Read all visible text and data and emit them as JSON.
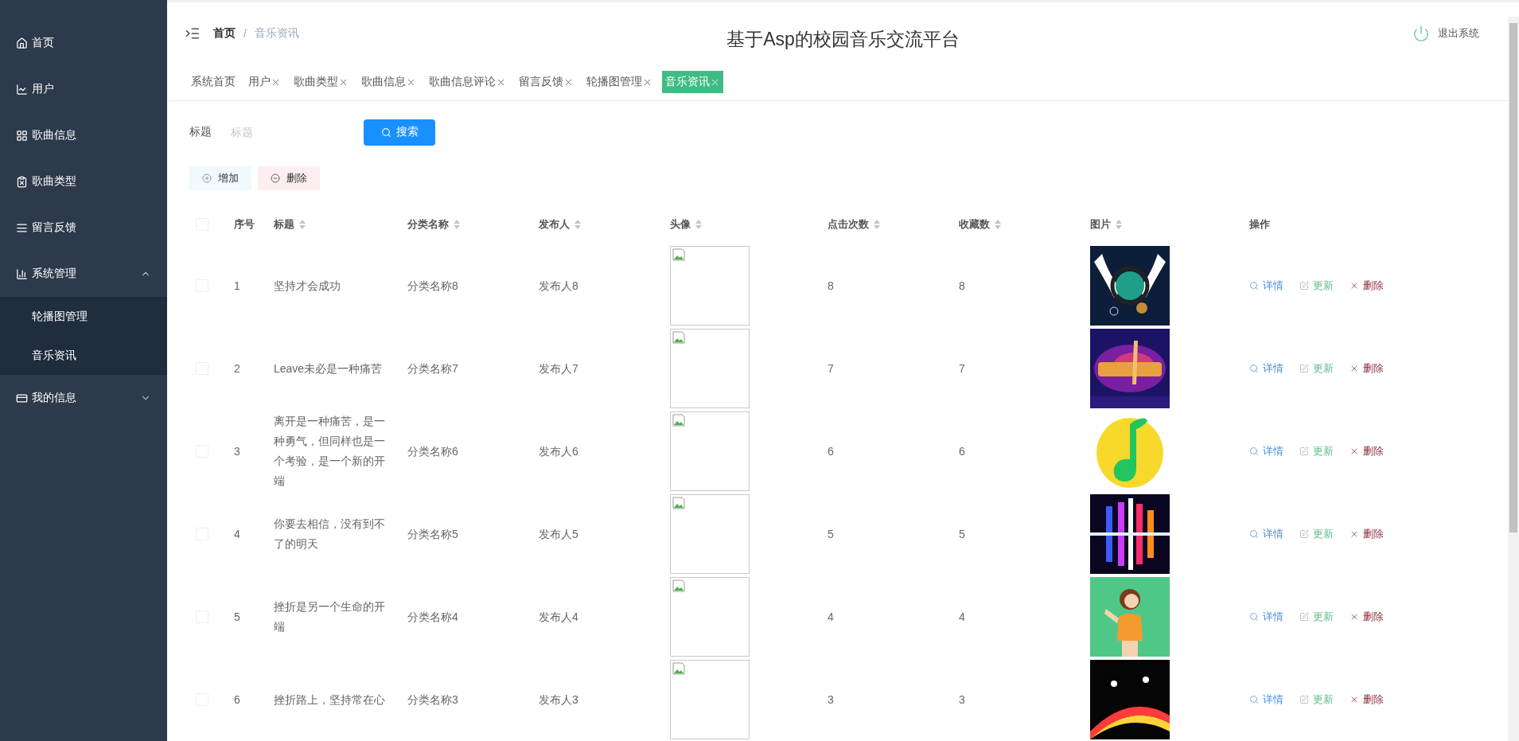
{
  "sidebar": {
    "items": [
      {
        "label": "首页"
      },
      {
        "label": "用户"
      },
      {
        "label": "歌曲信息"
      },
      {
        "label": "歌曲类型"
      },
      {
        "label": "留言反馈"
      },
      {
        "label": "系统管理",
        "expanded": true,
        "children": [
          {
            "label": "轮播图管理"
          },
          {
            "label": "音乐资讯"
          }
        ]
      },
      {
        "label": "我的信息",
        "expanded": false
      }
    ]
  },
  "header": {
    "breadcrumb": [
      "首页",
      "音乐资讯"
    ],
    "breadcrumb_separator": "/",
    "title": "基于Asp的校园音乐交流平台",
    "logout": "退出系统"
  },
  "tabs": [
    {
      "label": "系统首页",
      "closable": false,
      "selected": false
    },
    {
      "label": "用户",
      "closable": true,
      "selected": false
    },
    {
      "label": "歌曲类型",
      "closable": true,
      "selected": false
    },
    {
      "label": "歌曲信息",
      "closable": true,
      "selected": false
    },
    {
      "label": "歌曲信息评论",
      "closable": true,
      "selected": false
    },
    {
      "label": "留言反馈",
      "closable": true,
      "selected": false
    },
    {
      "label": "轮播图管理",
      "closable": true,
      "selected": false
    },
    {
      "label": "音乐资讯",
      "closable": true,
      "selected": true
    }
  ],
  "search": {
    "label": "标题",
    "placeholder": "标题",
    "button": "搜索"
  },
  "toolbar": {
    "add": "增加",
    "delete": "删除"
  },
  "table": {
    "select_all_checked": false,
    "columns": [
      {
        "label": "序号",
        "sortable": false
      },
      {
        "label": "标题",
        "sortable": true
      },
      {
        "label": "分类名称",
        "sortable": true
      },
      {
        "label": "发布人",
        "sortable": true
      },
      {
        "label": "头像",
        "sortable": true
      },
      {
        "label": "点击次数",
        "sortable": true
      },
      {
        "label": "收藏数",
        "sortable": true
      },
      {
        "label": "图片",
        "sortable": true
      },
      {
        "label": "操作",
        "sortable": false
      }
    ],
    "rows": [
      {
        "checked": false,
        "index": "1",
        "title": "坚持才会成功",
        "category": "分类名称8",
        "publisher": "发布人8",
        "clicks": "8",
        "favorites": "8",
        "actions": [
          "详情",
          "更新",
          "删除"
        ]
      },
      {
        "checked": false,
        "index": "2",
        "title": "Leave未必是一种痛苦",
        "category": "分类名称7",
        "publisher": "发布人7",
        "clicks": "7",
        "favorites": "7",
        "actions": [
          "详情",
          "更新",
          "删除"
        ]
      },
      {
        "checked": false,
        "index": "3",
        "title": "离开是一种痛苦，是一种勇气，但同样也是一个考验，是一个新的开端",
        "category": "分类名称6",
        "publisher": "发布人6",
        "clicks": "6",
        "favorites": "6",
        "actions": [
          "详情",
          "更新",
          "删除"
        ]
      },
      {
        "checked": false,
        "index": "4",
        "title": "你要去相信，没有到不了的明天",
        "category": "分类名称5",
        "publisher": "发布人5",
        "clicks": "5",
        "favorites": "5",
        "actions": [
          "详情",
          "更新",
          "删除"
        ]
      },
      {
        "checked": false,
        "index": "5",
        "title": "挫折是另一个生命的开端",
        "category": "分类名称4",
        "publisher": "发布人4",
        "clicks": "4",
        "favorites": "4",
        "actions": [
          "详情",
          "更新",
          "删除"
        ]
      },
      {
        "checked": false,
        "index": "6",
        "title": "挫折路上，坚持常在心",
        "category": "分类名称3",
        "publisher": "发布人3",
        "clicks": "3",
        "favorites": "3",
        "actions": [
          "详情",
          "更新",
          "删除"
        ]
      }
    ]
  }
}
